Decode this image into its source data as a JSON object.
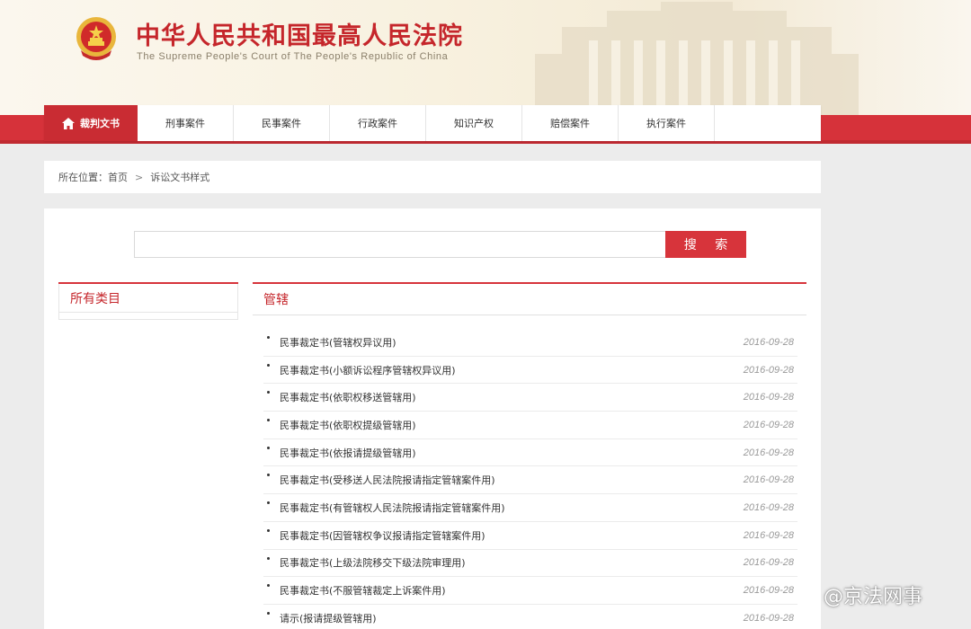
{
  "header": {
    "title_cn": "中华人民共和国最高人民法院",
    "title_en": "The Supreme People's Court of The People's Republic of China"
  },
  "nav": {
    "items": [
      {
        "label": "裁判文书",
        "icon": "home-icon",
        "active": true
      },
      {
        "label": "刑事案件"
      },
      {
        "label": "民事案件"
      },
      {
        "label": "行政案件"
      },
      {
        "label": "知识产权"
      },
      {
        "label": "赔偿案件"
      },
      {
        "label": "执行案件"
      }
    ]
  },
  "breadcrumb": {
    "prefix": "所在位置：首页",
    "separator": ">",
    "current": "诉讼文书样式"
  },
  "search": {
    "placeholder": "",
    "value": "",
    "button_label": "搜 索"
  },
  "sidebar": {
    "title": "所有类目"
  },
  "content": {
    "title": "管辖",
    "items": [
      {
        "title": "民事裁定书(管辖权异议用)",
        "date": "2016-09-28"
      },
      {
        "title": "民事裁定书(小额诉讼程序管辖权异议用)",
        "date": "2016-09-28"
      },
      {
        "title": "民事裁定书(依职权移送管辖用)",
        "date": "2016-09-28"
      },
      {
        "title": "民事裁定书(依职权提级管辖用)",
        "date": "2016-09-28"
      },
      {
        "title": "民事裁定书(依报请提级管辖用)",
        "date": "2016-09-28"
      },
      {
        "title": "民事裁定书(受移送人民法院报请指定管辖案件用)",
        "date": "2016-09-28"
      },
      {
        "title": "民事裁定书(有管辖权人民法院报请指定管辖案件用)",
        "date": "2016-09-28"
      },
      {
        "title": "民事裁定书(因管辖权争议报请指定管辖案件用)",
        "date": "2016-09-28"
      },
      {
        "title": "民事裁定书(上级法院移交下级法院审理用)",
        "date": "2016-09-28"
      },
      {
        "title": "民事裁定书(不服管辖裁定上诉案件用)",
        "date": "2016-09-28"
      },
      {
        "title": "请示(报请提级管辖用)",
        "date": "2016-09-28"
      }
    ]
  },
  "watermark": {
    "text": "@京法网事",
    "icon": "wechat-icon"
  },
  "colors": {
    "brand_red": "#d6323a",
    "title_red": "#c5262b"
  }
}
